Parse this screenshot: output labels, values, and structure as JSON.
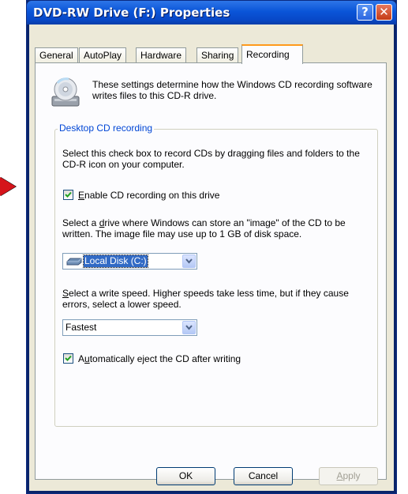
{
  "window": {
    "title": "DVD-RW Drive (F:) Properties",
    "help_glyph": "?",
    "close_glyph": "✕"
  },
  "tabs": [
    {
      "label": "General"
    },
    {
      "label": "AutoPlay"
    },
    {
      "label": "Hardware"
    },
    {
      "label": "Sharing"
    },
    {
      "label": "Recording"
    }
  ],
  "active_tab": "Recording",
  "panel": {
    "description": "These settings determine how the Windows CD recording software writes files to this CD-R drive.",
    "group_title": "Desktop CD recording",
    "group_intro": "Select this check box to record CDs by dragging files and folders to the CD-R icon on your computer.",
    "enable_checkbox": {
      "pre": "",
      "key": "E",
      "post": "nable CD recording on this drive",
      "checked": true
    },
    "drive_prompt": {
      "pre": "Select a ",
      "key": "d",
      "post": "rive where Windows can store an \"image\" of the CD to be written. The image file may use up to 1 GB of disk space."
    },
    "drive_select": {
      "value": "Local Disk (C:)",
      "icon": "hard-drive-icon"
    },
    "speed_prompt": {
      "pre": "",
      "key": "S",
      "post": "elect a write speed.  Higher speeds take less time, but if they cause errors, select a lower speed."
    },
    "speed_select": {
      "value": "Fastest"
    },
    "eject_checkbox": {
      "pre": "A",
      "key": "u",
      "post": "tomatically eject the CD after writing",
      "checked": true
    }
  },
  "buttons": {
    "ok": "OK",
    "cancel": "Cancel",
    "apply_key": "A",
    "apply_rest": "pply"
  },
  "colors": {
    "titlebar": "#0a55d8",
    "active_tab_highlight": "#ff9a1c",
    "group_title": "#0046d5",
    "selection": "#316ac5",
    "pointer_arrow": "#d5141b"
  }
}
